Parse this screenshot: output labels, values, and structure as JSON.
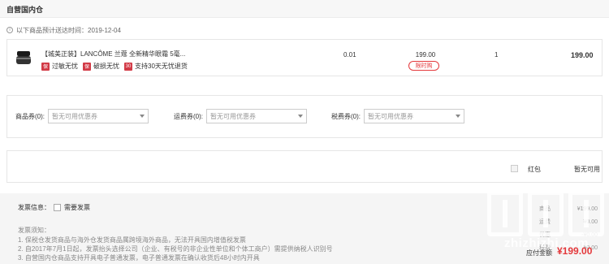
{
  "section": {
    "title": "自营国内仓",
    "arrival_text": "以下商品预计送达时间：2019-12-04"
  },
  "product": {
    "name": "【城美正装】LANCÔME 兰蔻 全新精华眼霜 5毫...",
    "services": [
      {
        "badge": "保",
        "label": "过敏无忧"
      },
      {
        "badge": "保",
        "label": "破损无忧"
      },
      {
        "badge": "30",
        "label": "支持30天无忧退货"
      }
    ],
    "tax": "0.01",
    "price": "199.00",
    "tag": "限时购",
    "quantity": "1",
    "subtotal": "199.00"
  },
  "coupons": [
    {
      "label": "商品券(0):",
      "placeholder": "暂无可用优惠券"
    },
    {
      "label": "运费券(0):",
      "placeholder": "暂无可用优惠券"
    },
    {
      "label": "税费券(0):",
      "placeholder": "暂无可用优惠券"
    }
  ],
  "red_packet": {
    "label": "红包",
    "status": "暂无可用"
  },
  "invoice": {
    "info_label": "发票信息：",
    "need_invoice": "需要发票",
    "notice_title": "发票须知：",
    "notices": [
      "1. 保税仓发货商品与海外仓发货商品属跨境海外商品，无法开具国内增值税发票",
      "2. 自2017年7月1日起，发票抬头选择公司（企业、有税号的非企业性单位和个体工商户）需提供纳税人识别号",
      "3. 自营国内仓商品支持开具电子普通发票，电子普通发票在确认收货后48小时内开具"
    ]
  },
  "summary": {
    "labels": [
      "商品",
      "运费",
      "优惠",
      "税费"
    ],
    "values": [
      "¥199.00",
      "¥0.00",
      "-¥0.00",
      "¥0.00"
    ],
    "pay_label": "应付金额",
    "pay_value": "¥199.00"
  },
  "watermark": {
    "text": "zhizhizhi.com"
  },
  "colors": {
    "accent": "#e4393c",
    "badge": "#d23a46"
  }
}
